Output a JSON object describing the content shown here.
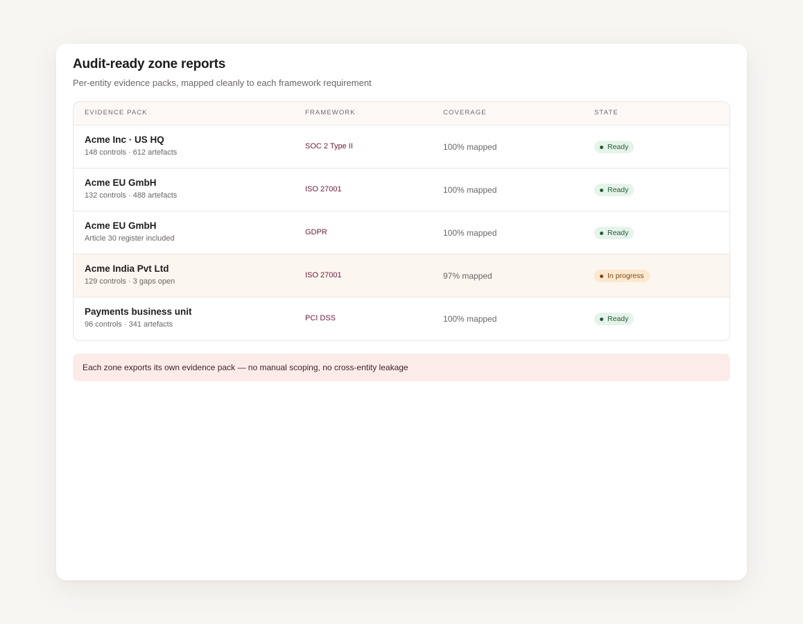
{
  "header": {
    "title": "Audit-ready zone reports",
    "subtitle": "Per-entity evidence packs, mapped cleanly to each framework requirement"
  },
  "table": {
    "columns": [
      "EVIDENCE PACK",
      "FRAMEWORK",
      "COVERAGE",
      "STATE"
    ],
    "rows": [
      {
        "entity": "Acme Inc · US HQ",
        "meta": "148 controls · 612 artefacts",
        "framework": "SOC 2 Type II",
        "coverage": "100% mapped",
        "state": "Ready",
        "status": "ready"
      },
      {
        "entity": "Acme EU GmbH",
        "meta": "132 controls · 488 artefacts",
        "framework": "ISO 27001",
        "coverage": "100% mapped",
        "state": "Ready",
        "status": "ready"
      },
      {
        "entity": "Acme EU GmbH",
        "meta": "Article 30 register included",
        "framework": "GDPR",
        "coverage": "100% mapped",
        "state": "Ready",
        "status": "ready"
      },
      {
        "entity": "Acme India Pvt Ltd",
        "meta": "129 controls · 3 gaps open",
        "framework": "ISO 27001",
        "coverage": "97% mapped",
        "state": "In progress",
        "status": "progress"
      },
      {
        "entity": "Payments business unit",
        "meta": "96 controls · 341 artefacts",
        "framework": "PCI DSS",
        "coverage": "100% mapped",
        "state": "Ready",
        "status": "ready"
      }
    ]
  },
  "note": {
    "text": "Each zone exports its own evidence pack — no manual scoping, no cross-entity leakage"
  },
  "colors": {
    "ready_bg": "#e6f3ea",
    "ready_text": "#1f5e35",
    "progress_bg": "#fbe8cf",
    "progress_text": "#7a4a12",
    "framework_text": "#6b1a3a",
    "note_bg": "#fcece9"
  }
}
